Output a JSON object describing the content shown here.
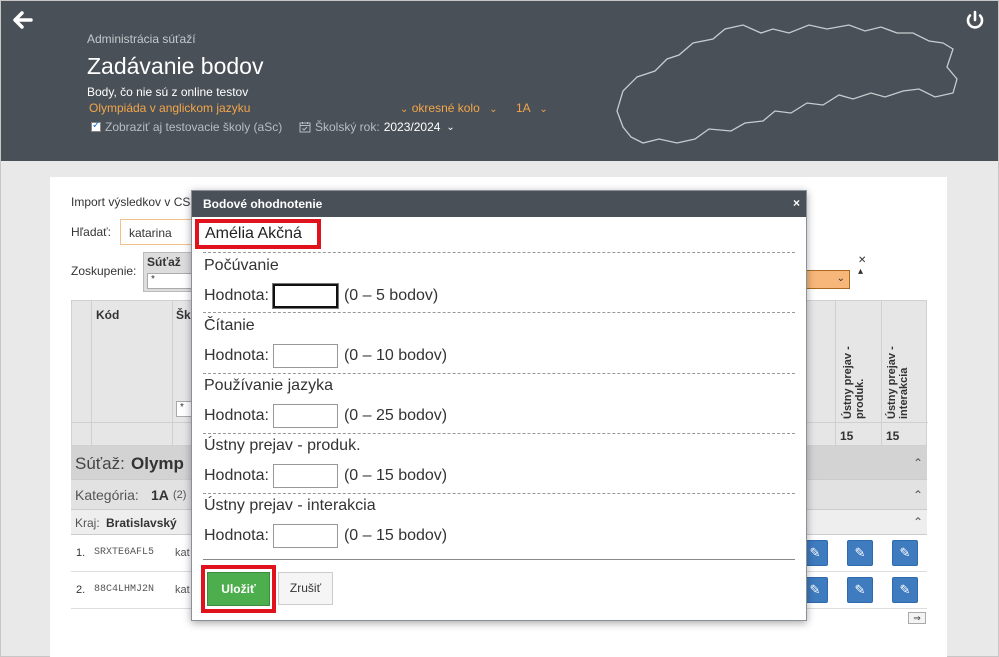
{
  "header": {
    "breadcrumb": "Administrácia súťaží",
    "title": "Zadávanie bodov",
    "subtitle": "Body, čo nie sú z online testov",
    "competition": "Olympiáda v anglickom jazyku",
    "round": "okresné kolo",
    "category": "1A",
    "show_test_schools": "Zobraziť aj testovacie školy (aSc)",
    "school_year_label": "Školský rok:",
    "school_year": "2023/2024"
  },
  "background": {
    "import_label": "Import výsledkov v CS",
    "search_label": "Hľadať:",
    "search_value": "katarina",
    "grouping_label": "Zoskupenie:",
    "group_field": "Súťaž",
    "group_field_value": "*",
    "col_kod": "Kód",
    "col_sk": "Šk",
    "filter_value": "*",
    "vcols": [
      {
        "label": "Ústny prejav - produk.",
        "max": "15"
      },
      {
        "label": "Ústny prejav - interakcia",
        "max": "15"
      }
    ],
    "group_sutaz_label": "Súťaž:",
    "group_sutaz_value": "Olymp",
    "group_kat_label": "Kategória:",
    "group_kat_value": "1A",
    "group_kat_count": "(2)",
    "group_kraj_label": "Kraj:",
    "group_kraj_value": "Bratislavský",
    "rows": [
      {
        "num": "1.",
        "code": "SRXTE6AFL5",
        "school": "kat"
      },
      {
        "num": "2.",
        "code": "88C4LHMJ2N",
        "school": "kat"
      }
    ]
  },
  "modal": {
    "title": "Bodové ohodnotenie",
    "close": "×",
    "student_name": "Amélia Akčná",
    "value_label": "Hodnota:",
    "sections": [
      {
        "name": "Počúvanie",
        "value": "",
        "range": "(0 – 5 bodov)"
      },
      {
        "name": "Čítanie",
        "value": "",
        "range": "(0 – 10 bodov)"
      },
      {
        "name": "Používanie jazyka",
        "value": "",
        "range": "(0 – 25 bodov)"
      },
      {
        "name": "Ústny prejav - produk.",
        "value": "",
        "range": "(0 – 15 bodov)"
      },
      {
        "name": "Ústny prejav - interakcia",
        "value": "",
        "range": "(0 – 15 bodov)"
      }
    ],
    "save_label": "Uložiť",
    "cancel_label": "Zrušiť"
  },
  "colors": {
    "header_bg": "#495057",
    "accent_orange": "#f3a64a",
    "save_green": "#4cae4c",
    "highlight_red": "#e0121b",
    "edit_blue": "#3f7bbf"
  }
}
